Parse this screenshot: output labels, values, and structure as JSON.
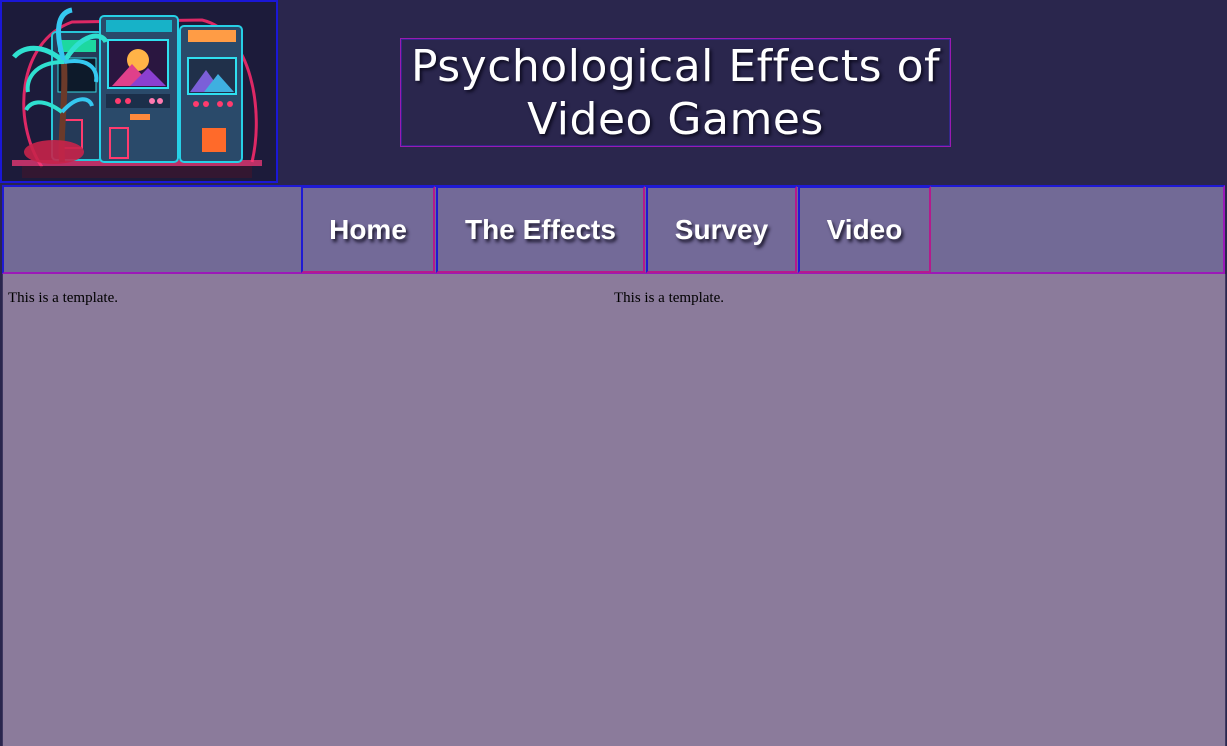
{
  "header": {
    "logo_icon": "arcade-cabinets-palm-tree-neon-image",
    "title": "Psychological Effects of Video Games"
  },
  "nav": {
    "items": [
      {
        "label": "Home"
      },
      {
        "label": "The Effects"
      },
      {
        "label": "Survey"
      },
      {
        "label": "Video"
      }
    ]
  },
  "content": {
    "left_text": "This is a template.",
    "right_text": "This is a template."
  },
  "colors": {
    "header_bg": "#2a264d",
    "nav_bg": "#726a96",
    "content_bg": "#8b7b9b",
    "border_blue": "#1f1ad4",
    "border_magenta": "#b41a8c"
  }
}
